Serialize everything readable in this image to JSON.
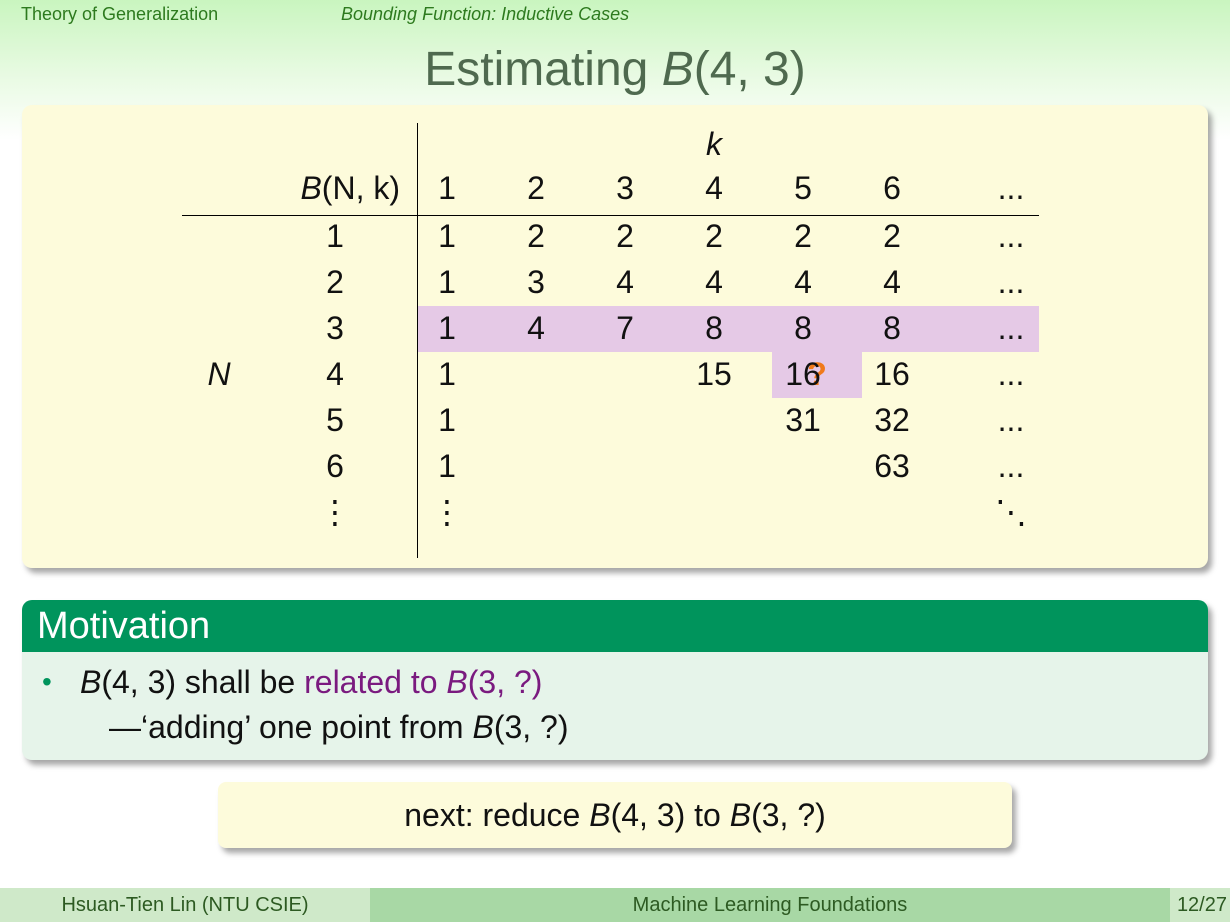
{
  "header": {
    "section": "Theory of Generalization",
    "subsection": "Bounding Function: Inductive Cases"
  },
  "slide": {
    "title_prefix": "Estimating ",
    "title_math": "B",
    "title_args": "(4, 3)"
  },
  "table": {
    "corner_label_fn": "B",
    "corner_label_args": "(N, k)",
    "k_label": "k",
    "n_label": "N",
    "k_headers": [
      "1",
      "2",
      "3",
      "4",
      "5",
      "6",
      "..."
    ],
    "rows": [
      {
        "n": "1",
        "cells": [
          "1",
          "2",
          "2",
          "2",
          "2",
          "2",
          "..."
        ]
      },
      {
        "n": "2",
        "cells": [
          "1",
          "3",
          "4",
          "4",
          "4",
          "4",
          "..."
        ]
      },
      {
        "n": "3",
        "cells": [
          "1",
          "4",
          "7",
          "8",
          "8",
          "8",
          "..."
        ]
      },
      {
        "n": "4",
        "cells": [
          "1",
          "",
          "?",
          "15",
          "16",
          "16",
          "..."
        ]
      },
      {
        "n": "5",
        "cells": [
          "1",
          "",
          "",
          "",
          "31",
          "32",
          "..."
        ]
      },
      {
        "n": "6",
        "cells": [
          "1",
          "",
          "",
          "",
          "",
          "63",
          "..."
        ]
      },
      {
        "n": "⋮",
        "cells": [
          "⋮",
          "",
          "",
          "",
          "",
          "",
          "⋱"
        ]
      }
    ],
    "highlight_row_n": "3",
    "highlight_cell": {
      "n": "4",
      "k": "3"
    },
    "highlight_color": "#e5c9e6",
    "question_color": "#f07a1a"
  },
  "motivation": {
    "heading": "Motivation",
    "line1_a": "B",
    "line1_b": "(4, 3) shall be ",
    "line1_c": "related to ",
    "line1_d": "B",
    "line1_e": "(3, ?)",
    "line2_a": "—‘adding’ one point from ",
    "line2_b": "B",
    "line2_c": "(3, ?)"
  },
  "next": {
    "a": "next: reduce ",
    "b": "B",
    "c": "(4, 3) to ",
    "d": "B",
    "e": "(3, ?)"
  },
  "footer": {
    "author": "Hsuan-Tien Lin  (NTU CSIE)",
    "course": "Machine Learning Foundations",
    "page": "12/27"
  }
}
